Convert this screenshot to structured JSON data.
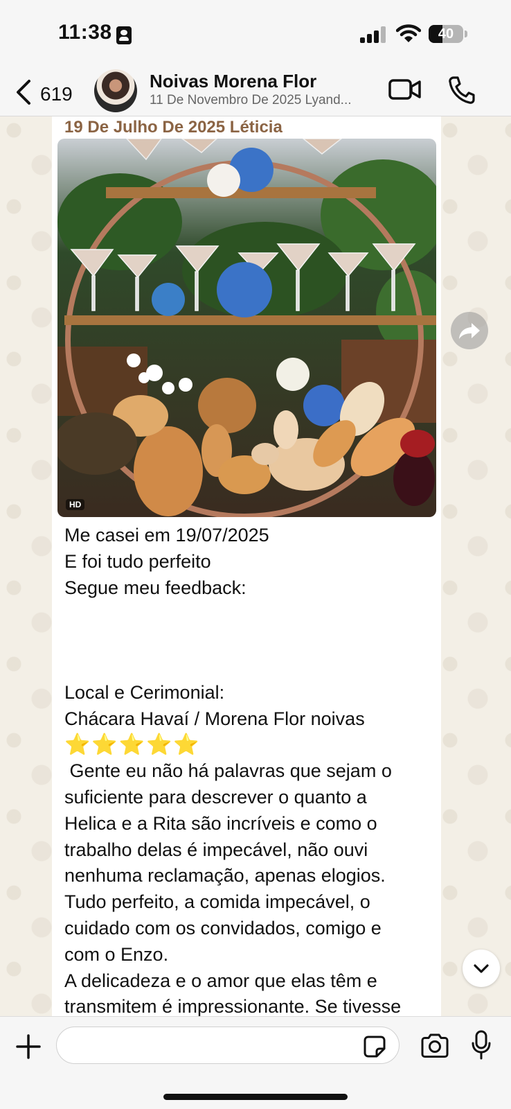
{
  "status_bar": {
    "time": "11:38",
    "battery_percent": "40",
    "battery_level": 0.4
  },
  "header": {
    "back_count": "619",
    "title": "Noivas Morena Flor",
    "subtitle": "11 De Novembro De 2025 Lyand..."
  },
  "message": {
    "sender": "19 De Julho De 2025 Léticia",
    "hd_badge": "HD",
    "lines": [
      "Me casei em 19/07/2025",
      "E foi tudo perfeito",
      "Segue meu feedback:",
      "",
      "",
      "",
      "Local e Cerimonial:",
      "Chácara Havaí / Morena Flor noivas",
      "⭐⭐⭐⭐⭐",
      " Gente eu não há palavras que sejam o",
      "suficiente para descrever o quanto a",
      "Helica e a Rita são incríveis e como o",
      "trabalho delas é impecável, não ouvi",
      "nenhuma reclamação, apenas elogios.",
      "Tudo perfeito, a comida impecável, o",
      "cuidado com os convidados, comigo e",
      "com o Enzo.",
      "A delicadeza e o amor que elas têm e",
      "transmitem é impressionante. Se tivesse"
    ]
  },
  "input": {
    "value": "",
    "placeholder": ""
  },
  "icons": {
    "back": "chevron-left-icon",
    "video": "video-camera-icon",
    "call": "phone-icon",
    "forward": "forward-arrow-icon",
    "scroll": "chevron-down-icon",
    "plus": "plus-icon",
    "sticker": "sticker-icon",
    "camera": "camera-icon",
    "mic": "microphone-icon"
  },
  "colors": {
    "sender_name": "#8b6444",
    "chat_background": "#f3efe6"
  }
}
